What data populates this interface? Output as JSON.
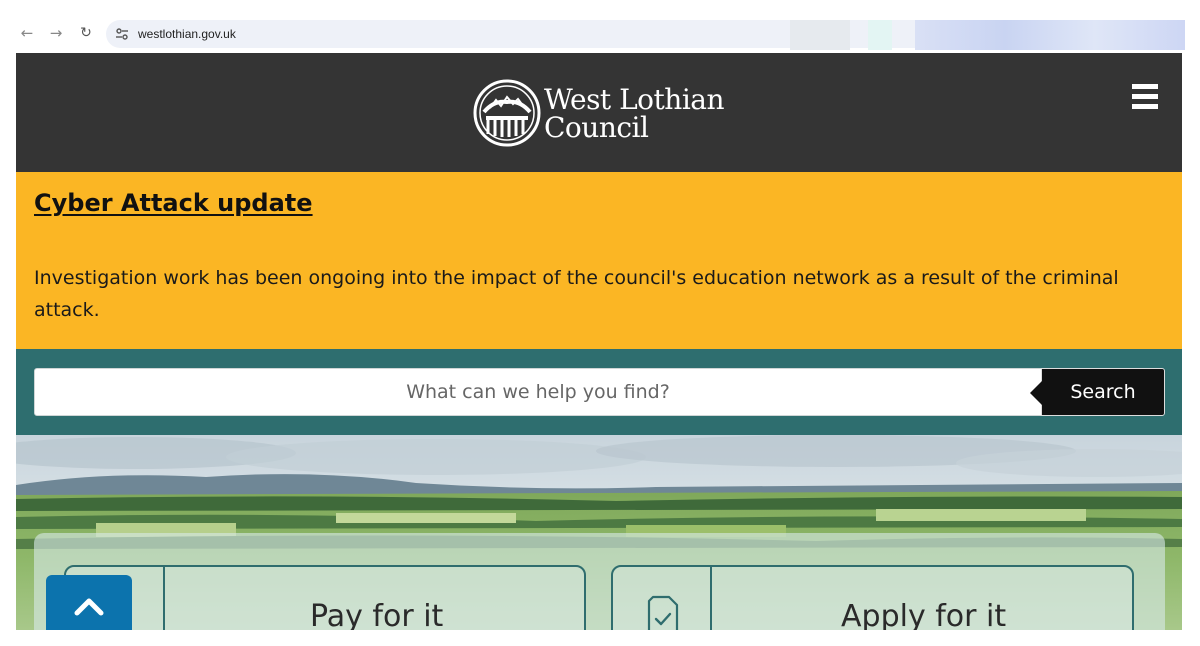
{
  "browser": {
    "url": "westlothian.gov.uk",
    "icons": [
      "back-arrow",
      "forward-arrow",
      "reload",
      "site-settings"
    ]
  },
  "header": {
    "logo_line1": "West Lothian",
    "logo_line2": "Council",
    "icons": [
      "logo-emblem",
      "hamburger-menu"
    ]
  },
  "alert": {
    "title": "Cyber Attack update",
    "body": "Investigation work has been ongoing into the impact of the council's education network as a result of the criminal attack."
  },
  "search": {
    "placeholder": "What can we help you find?",
    "button_label": "Search"
  },
  "cards": [
    {
      "label": "Pay for it",
      "icon": "payment-icon"
    },
    {
      "label": "Apply for it",
      "icon": "checklist-document-icon"
    }
  ],
  "back_to_top": {
    "icon": "chevron-up-icon"
  },
  "colors": {
    "header_bg": "#343434",
    "alert_bg": "#fbb624",
    "search_band_bg": "#2e6e6f",
    "search_button_bg": "#111111",
    "card_border": "#2f6d6e",
    "back_to_top_bg": "#0c73ad"
  }
}
